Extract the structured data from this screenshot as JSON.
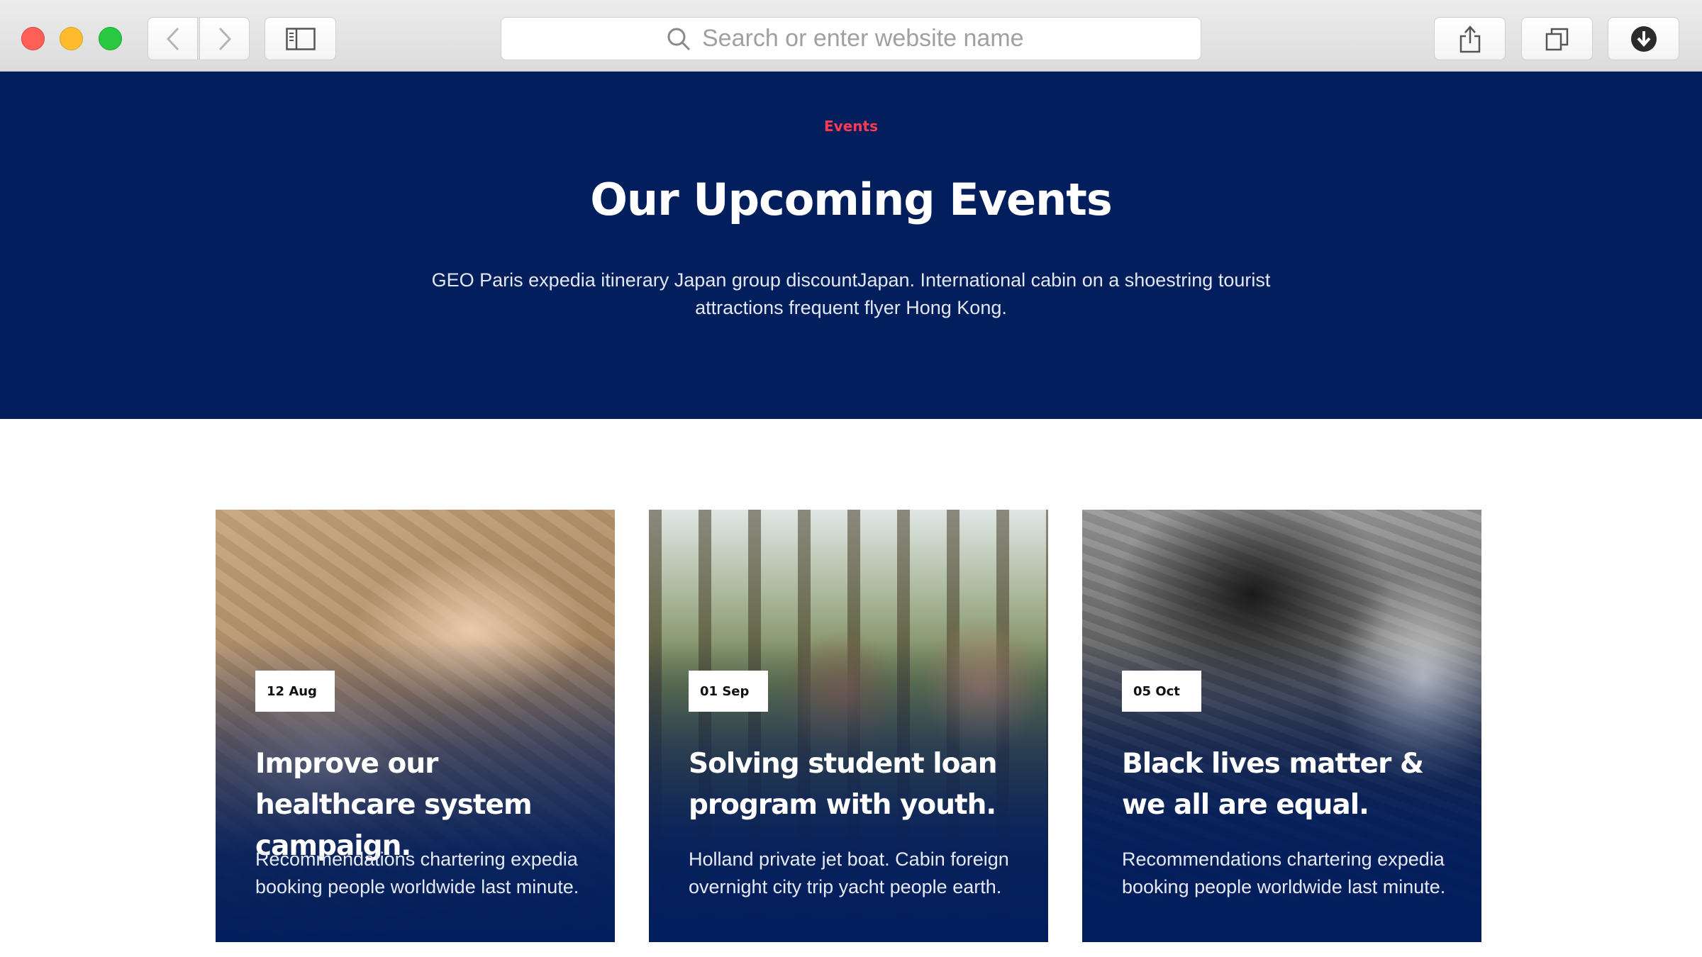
{
  "browser": {
    "search_placeholder": "Search or enter website name"
  },
  "hero": {
    "eyebrow": "Events",
    "title": "Our Upcoming Events",
    "description": "GEO Paris expedia itinerary Japan group discountJapan. International cabin on a shoestring tourist attractions frequent flyer Hong Kong."
  },
  "events": [
    {
      "date": "12 Aug",
      "title": "Improve our healthcare system campaign.",
      "text": "Recommendations chartering expedia booking people worldwide last minute."
    },
    {
      "date": "01 Sep",
      "title": "Solving student loan program with youth.",
      "text": "Holland private jet boat. Cabin foreign overnight city trip yacht people earth."
    },
    {
      "date": "05 Oct",
      "title": "Black lives matter & we all are equal.",
      "text": "Recommendations chartering expedia booking people worldwide last minute."
    }
  ],
  "colors": {
    "navy": "#021e5c",
    "accent_red": "#ff3b53"
  }
}
